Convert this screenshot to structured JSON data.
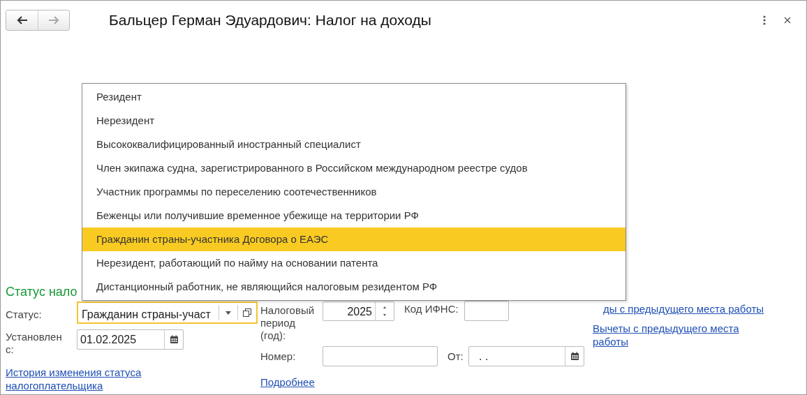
{
  "window": {
    "title": "Бальцер Герман Эдуардович: Налог на доходы"
  },
  "status_section": {
    "heading": "Статус нало",
    "status_label": "Статус:",
    "status_value": "Гражданин страны-участ",
    "established_label": "Установлен с:",
    "established_date": "01.02.2025",
    "history_link": "История изменения статуса налогоплательщика"
  },
  "tax_section": {
    "period_label": "Налоговый период (год):",
    "period_value": "2025",
    "ifns_label": "Код ИФНС:",
    "number_label": "Номер:",
    "from_label": "От:",
    "from_value": ". .",
    "more_link": "Подробнее"
  },
  "links": [
    "ды с предыдущего места работы",
    "Вычеты с предыдущего места работы"
  ],
  "dropdown": {
    "items": [
      {
        "label": "Резидент",
        "selected": false
      },
      {
        "label": "Нерезидент",
        "selected": false
      },
      {
        "label": "Высококвалифицированный иностранный специалист",
        "selected": false
      },
      {
        "label": "Член экипажа судна, зарегистрированного в Российском международном реестре судов",
        "selected": false
      },
      {
        "label": "Участник программы по переселению соотечественников",
        "selected": false
      },
      {
        "label": "Беженцы или получившие временное убежище на территории РФ",
        "selected": false
      },
      {
        "label": "Гражданин страны-участника Договора о ЕАЭС",
        "selected": true
      },
      {
        "label": "Нерезидент, работающий по найму на основании патента",
        "selected": false
      },
      {
        "label": "Дистанционный работник, не являющийся налоговым резидентом РФ",
        "selected": false
      }
    ]
  }
}
